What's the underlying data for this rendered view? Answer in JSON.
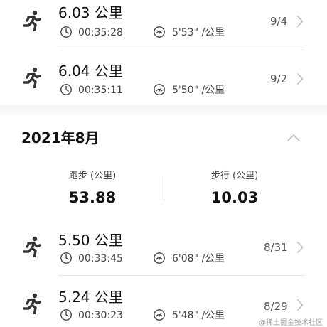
{
  "previous_records": [
    {
      "distance": "6.03 公里",
      "duration": "00:35:28",
      "pace": "5'53\" /公里",
      "date": "9/4"
    },
    {
      "distance": "6.04 公里",
      "duration": "00:35:11",
      "pace": "5'50\" /公里",
      "date": "9/2"
    }
  ],
  "month_section": {
    "title": "2021年8月",
    "run_label": "跑步 (公里)",
    "run_total": "53.88",
    "walk_label": "步行 (公里)",
    "walk_total": "10.03"
  },
  "month_records": [
    {
      "distance": "5.50 公里",
      "duration": "00:33:45",
      "pace": "6'08\" /公里",
      "date": "8/31"
    },
    {
      "distance": "5.24 公里",
      "duration": "00:30:23",
      "pace": "5'48\" /公里",
      "date": "8/29"
    }
  ],
  "icons": {
    "activity": "running-person-icon",
    "duration": "clock-icon",
    "pace": "speedometer-icon",
    "chevron": "chevron-right-icon",
    "collapse": "chevron-up-icon"
  },
  "watermark": "@稀土掘金技术社区"
}
